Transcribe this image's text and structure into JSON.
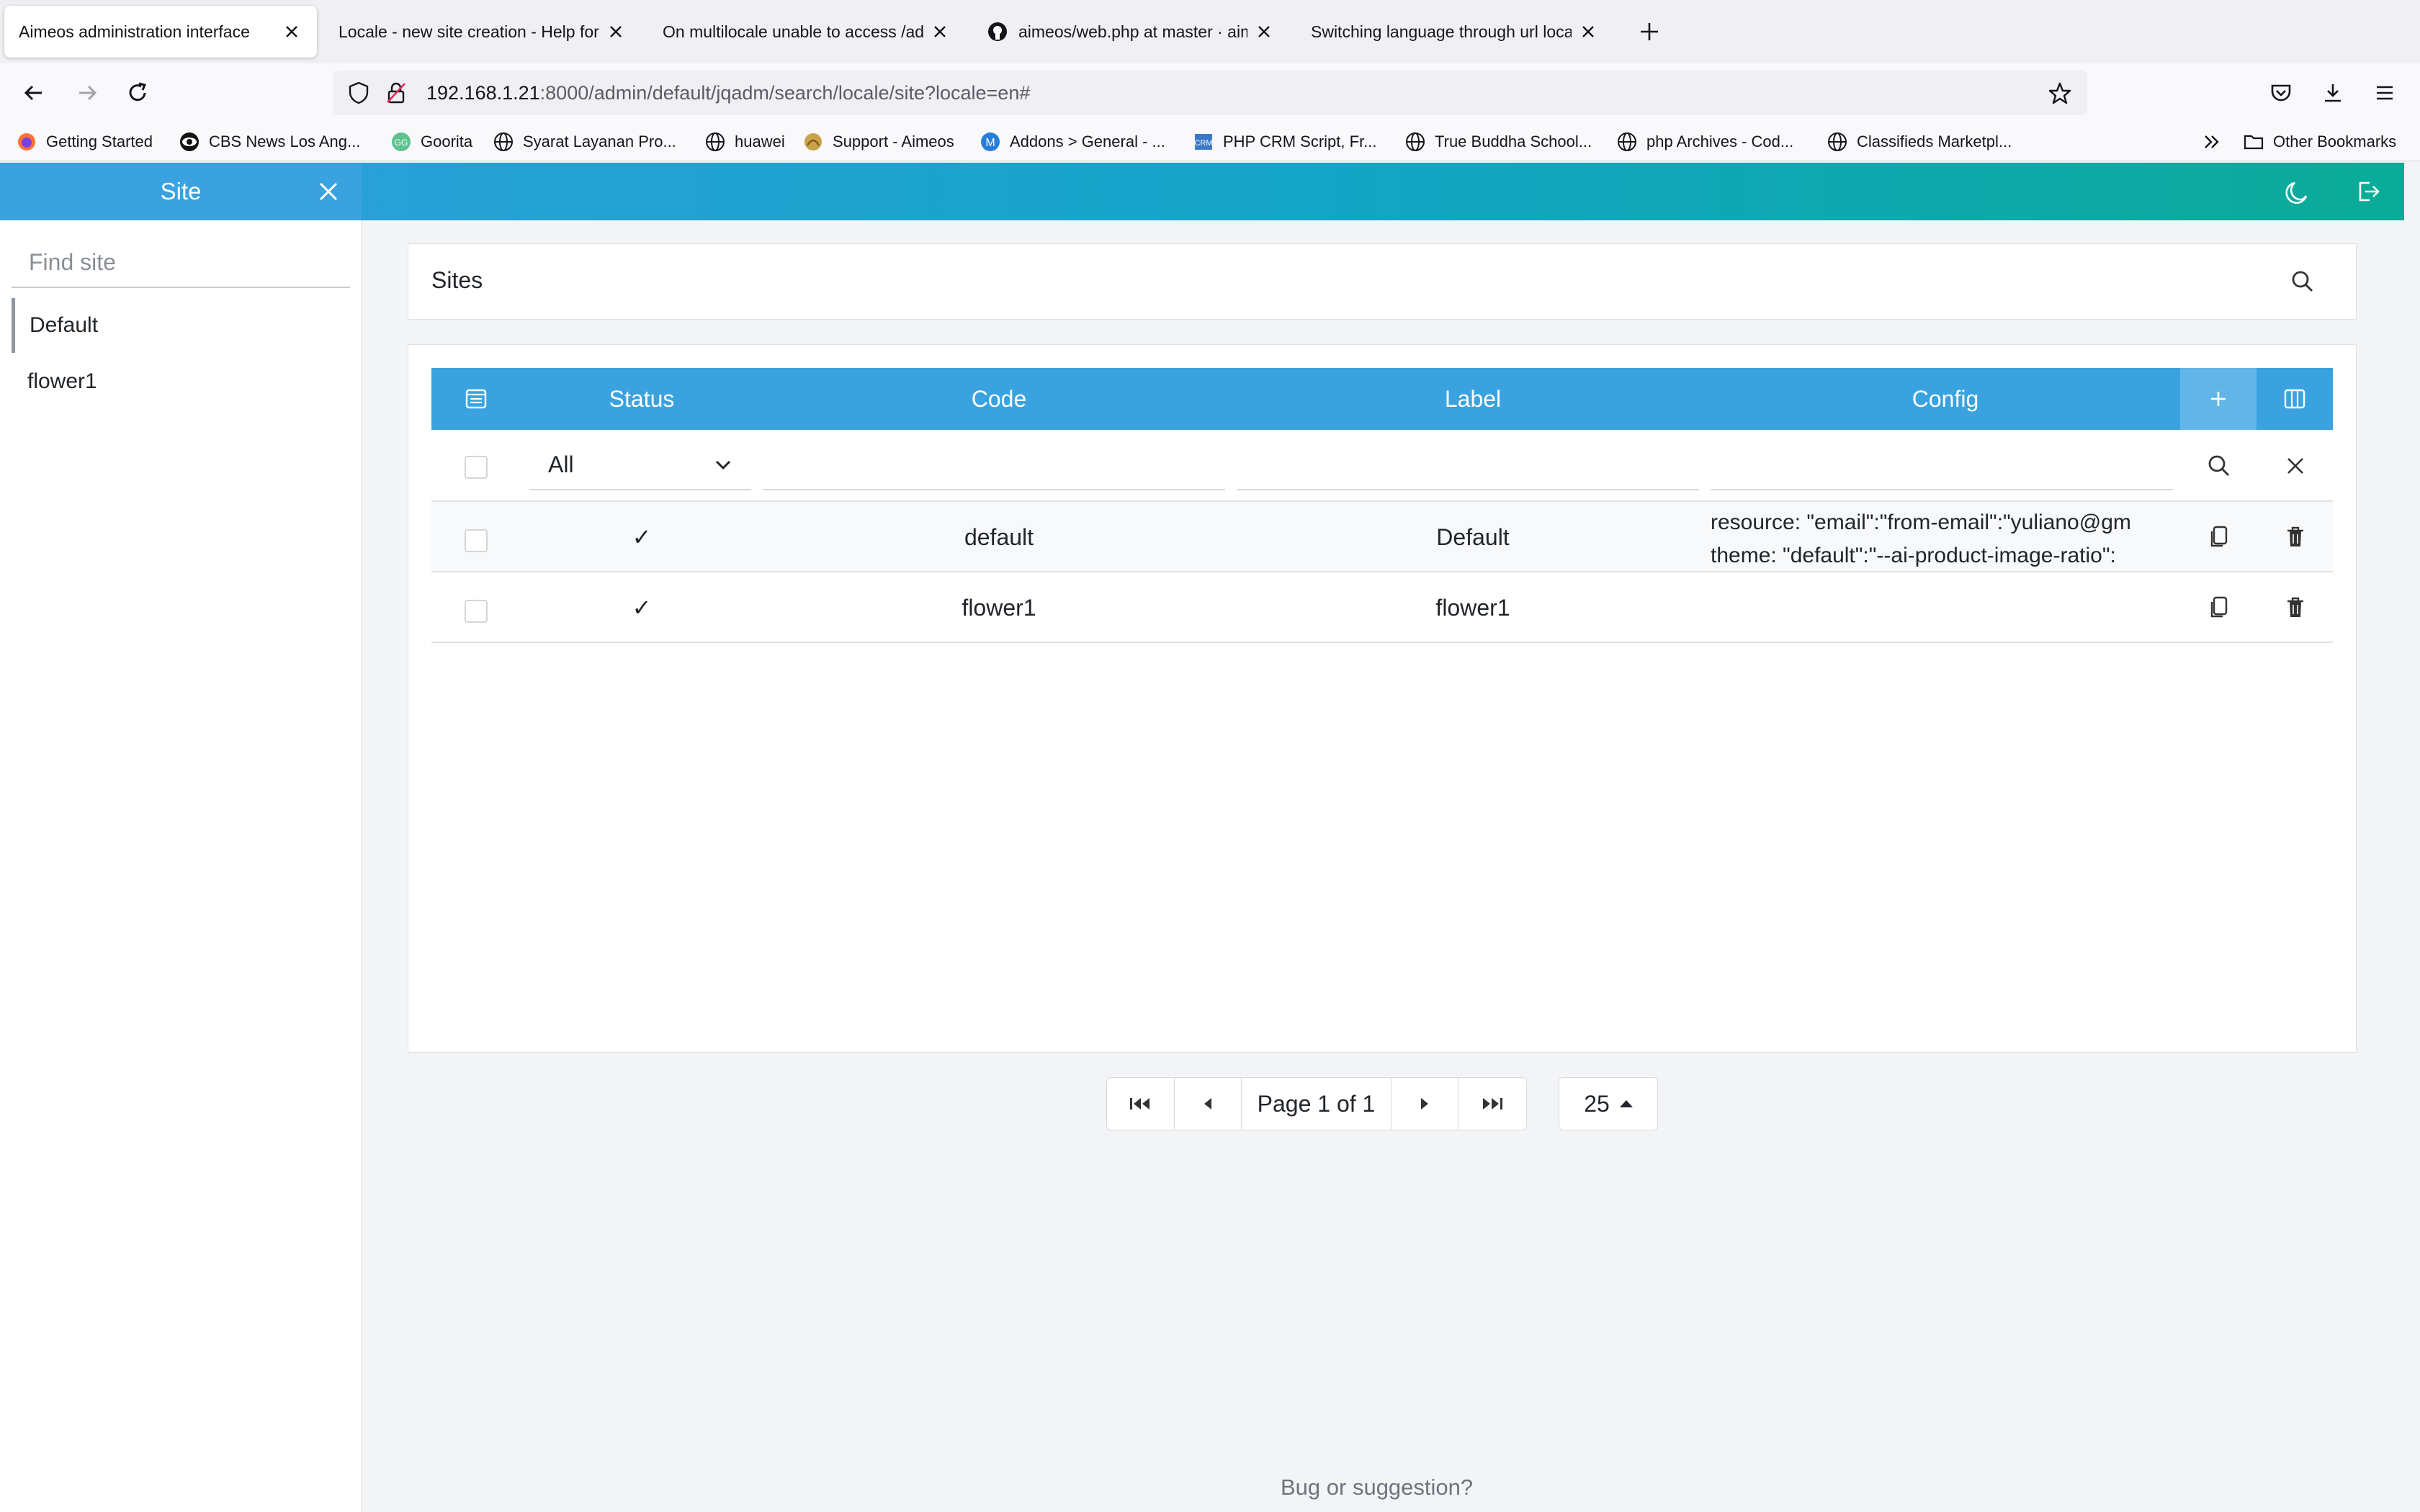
{
  "browser": {
    "tabs": [
      {
        "title": "Aimeos administration interface",
        "favicon": "none"
      },
      {
        "title": "Locale - new site creation - Help for",
        "favicon": "none"
      },
      {
        "title": "On multilocale unable to access /adr",
        "favicon": "none"
      },
      {
        "title": "aimeos/web.php at master · aim",
        "favicon": "github-icon"
      },
      {
        "title": "Switching language through url loca",
        "favicon": "none"
      }
    ],
    "url_host": "192.168.1.21",
    "url_path": ":8000/admin/default/jqadm/search/locale/site?locale=en#",
    "bookmarks": [
      {
        "label": "Getting Started",
        "icon": "firefox-icon"
      },
      {
        "label": "CBS News Los Ang...",
        "icon": "cbs-eye-icon"
      },
      {
        "label": "Goorita",
        "icon": "goorita-icon"
      },
      {
        "label": "Syarat Layanan Pro...",
        "icon": "globe-icon"
      },
      {
        "label": "huawei",
        "icon": "globe-icon"
      },
      {
        "label": "Support - Aimeos",
        "icon": "aimeos-icon"
      },
      {
        "label": "Addons > General - ...",
        "icon": "addons-icon"
      },
      {
        "label": "PHP CRM Script, Fr...",
        "icon": "php-crm-icon"
      },
      {
        "label": "True Buddha School...",
        "icon": "globe-icon"
      },
      {
        "label": "php Archives - Cod...",
        "icon": "globe-icon"
      },
      {
        "label": "Classifieds Marketpl...",
        "icon": "globe-icon"
      }
    ],
    "other_bookmarks": "Other Bookmarks"
  },
  "sidebar": {
    "title": "Site",
    "search_placeholder": "Find site",
    "sites": [
      {
        "label": "Default",
        "active": true
      },
      {
        "label": "flower1",
        "active": false
      }
    ]
  },
  "main": {
    "search_title": "Sites",
    "columns": {
      "status": "Status",
      "code": "Code",
      "label": "Label",
      "config": "Config"
    },
    "filter": {
      "status_selected": "All"
    },
    "rows": [
      {
        "status": "✓",
        "code": "default",
        "label": "Default",
        "config_lines": [
          "resource: \"email\":\"from-email\":\"yuliano@gm",
          "theme: \"default\":\"--ai-product-image-ratio\":"
        ]
      },
      {
        "status": "✓",
        "code": "flower1",
        "label": "flower1",
        "config_lines": [
          "",
          ""
        ]
      }
    ],
    "pagination": {
      "page_text": "Page 1 of 1",
      "per_page": "25"
    },
    "footer": "Bug or suggestion?"
  },
  "colors": {
    "header_gradient_start": "#2f9fdc",
    "header_gradient_end": "#0aab97",
    "table_header": "#3aa3df"
  }
}
